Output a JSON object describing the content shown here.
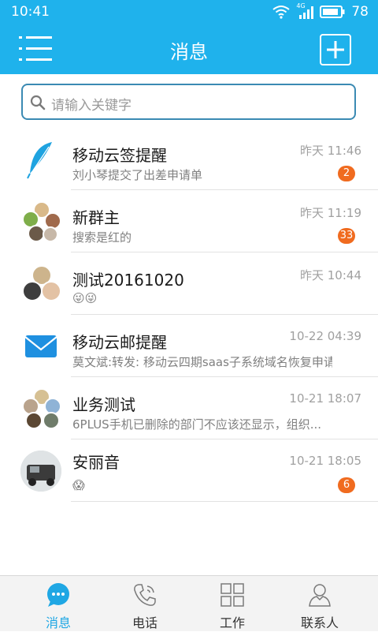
{
  "status_bar": {
    "time": "10:41",
    "battery": "78",
    "network": "4G"
  },
  "header": {
    "title": "消息"
  },
  "search": {
    "placeholder": "请输入关键字"
  },
  "conversations": [
    {
      "name": "移动云签提醒",
      "preview": "刘小琴提交了出差申请单",
      "time": "昨天 11:46",
      "badge": "2",
      "avatar": "feather-icon"
    },
    {
      "name": "新群主",
      "preview": "搜索是红的",
      "time": "昨天 11:19",
      "badge": "33",
      "avatar": "group-avatar"
    },
    {
      "name": "测试20161020",
      "preview": "😜😜",
      "time": "昨天 10:44",
      "badge": "",
      "avatar": "group-avatar"
    },
    {
      "name": "移动云邮提醒",
      "preview": "莫文斌:转发: 移动云四期saas子系统域名恢复申请",
      "time": "10-22 04:39",
      "badge": "",
      "avatar": "mail-icon"
    },
    {
      "name": "业务测试",
      "preview": "6PLUS手机已删除的部门不应该还显示，组织...",
      "time": "10-21 18:07",
      "badge": "",
      "avatar": "group-avatar"
    },
    {
      "name": "安丽音",
      "preview": "😱",
      "time": "10-21 18:05",
      "badge": "6",
      "avatar": "photo-avatar"
    }
  ],
  "tabs": [
    {
      "label": "消息",
      "icon": "chat-bubble-icon",
      "active": true
    },
    {
      "label": "电话",
      "icon": "phone-icon",
      "active": false
    },
    {
      "label": "工作",
      "icon": "grid-icon",
      "active": false
    },
    {
      "label": "联系人",
      "icon": "person-icon",
      "active": false
    }
  ],
  "colors": {
    "primary": "#1fb2ec",
    "badge": "#f06b1f",
    "active_tab": "#1fa7e4"
  }
}
